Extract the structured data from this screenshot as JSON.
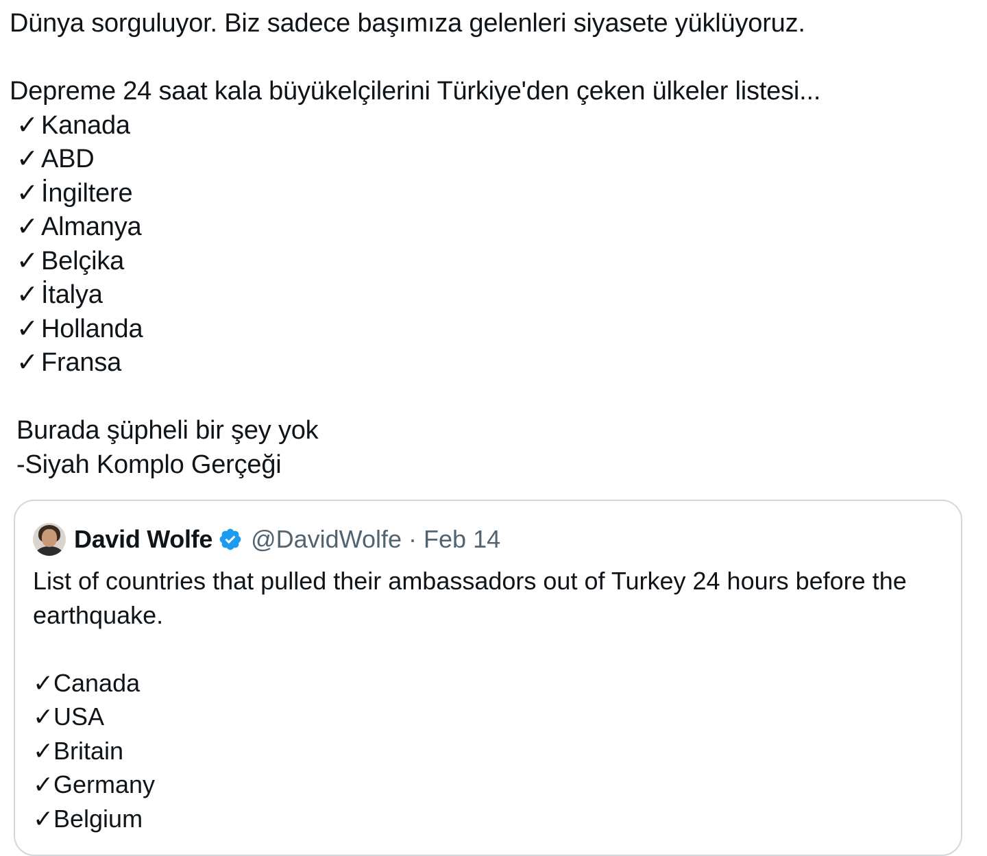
{
  "tweet": {
    "lines": [
      "Dünya sorguluyor. Biz sadece başımıza gelenleri siyasete yüklüyoruz.",
      "Depreme 24 saat kala büyükelçilerini Türkiye'den çeken ülkeler listesi..."
    ],
    "check_glyph": "✓",
    "countries": [
      "Kanada",
      "ABD",
      "İngiltere",
      "Almanya",
      "Belçika",
      "İtalya",
      "Hollanda",
      "Fransa"
    ],
    "closing": [
      "Burada şüpheli bir şey yok",
      "-Siyah Komplo Gerçeği"
    ]
  },
  "quoted_tweet": {
    "author_name": "David Wolfe",
    "verified_icon": "verified-badge-icon",
    "handle": "@DavidWolfe",
    "separator": "·",
    "date": "Feb 14",
    "text": "List of countries that pulled their ambassadors out of Turkey 24 hours before the earthquake.",
    "countries": [
      "Canada",
      "USA",
      "Britain",
      "Germany",
      "Belgium"
    ]
  },
  "colors": {
    "text": "#0f1419",
    "muted": "#536471",
    "border": "#cfd9de",
    "verified": "#1d9bf0"
  }
}
